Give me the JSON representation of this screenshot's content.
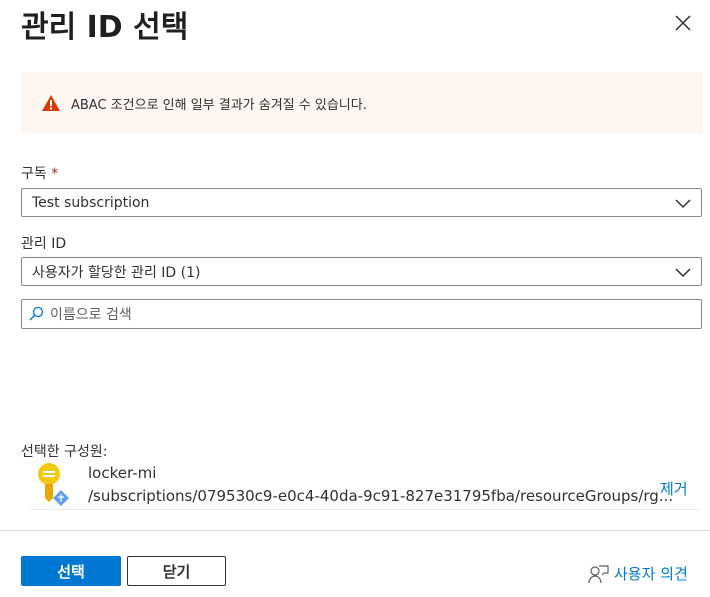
{
  "title": "관리 ID 선택",
  "warning": "ABAC 조건으로 인해 일부 결과가 숨겨질 수 있습니다.",
  "subscription": {
    "label": "구독",
    "required": "*",
    "value": "Test subscription"
  },
  "managed_id": {
    "label": "관리 ID",
    "value": "사용자가 할당한 관리 ID (1)"
  },
  "search": {
    "placeholder": "이름으로 검색"
  },
  "selected": {
    "label": "선택한 구성원:",
    "members": [
      {
        "name": "locker-mi",
        "path": "/subscriptions/079530c9-e0c4-40da-9c91-827e31795fba/resourceGroups/rg...",
        "remove": "제거"
      }
    ]
  },
  "footer": {
    "select": "선택",
    "close": "닫기",
    "feedback": "사용자 의견"
  },
  "colors": {
    "accent": "#0078d4",
    "warning": "#d83b01"
  }
}
